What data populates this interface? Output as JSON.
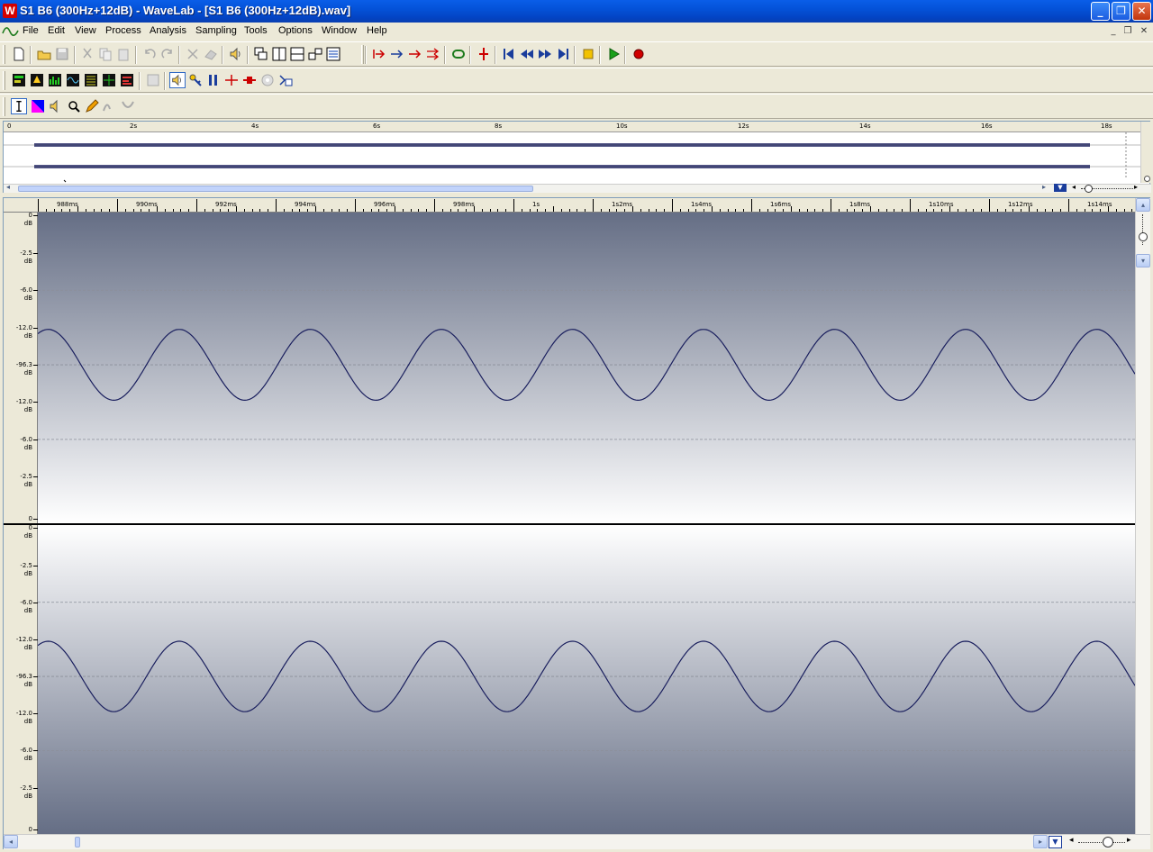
{
  "window": {
    "title": "S1 B6 (300Hz+12dB) - WaveLab - [S1 B6 (300Hz+12dB).wav]",
    "app_icon": "W"
  },
  "menu": [
    "File",
    "Edit",
    "View",
    "Process",
    "Analysis",
    "Sampling",
    "Tools",
    "Options",
    "Window",
    "Help"
  ],
  "overview": {
    "ruler_labels": [
      "0",
      "2s",
      "4s",
      "6s",
      "8s",
      "10s",
      "12s",
      "14s",
      "16s",
      "18s"
    ]
  },
  "editor": {
    "ruler_labels": [
      "988ms",
      "990ms",
      "992ms",
      "994ms",
      "996ms",
      "998ms",
      "1s",
      "1s2ms",
      "1s4ms",
      "1s6ms",
      "1s8ms",
      "1s10ms",
      "1s12ms",
      "1s14ms"
    ],
    "db_labels_top": [
      {
        "value": "0",
        "unit": "dB"
      },
      {
        "value": "-2.5",
        "unit": "dB"
      },
      {
        "value": "-6.0",
        "unit": "dB"
      },
      {
        "value": "-12.0",
        "unit": "dB"
      },
      {
        "value": "-96.3",
        "unit": "dB"
      },
      {
        "value": "-12.0",
        "unit": "dB"
      },
      {
        "value": "-6.0",
        "unit": "dB"
      },
      {
        "value": "-2.5",
        "unit": "dB"
      },
      {
        "value": "0",
        "unit": ""
      }
    ],
    "db_labels_bottom": [
      {
        "value": "0",
        "unit": "dB"
      },
      {
        "value": "-2.5",
        "unit": "dB"
      },
      {
        "value": "-6.0",
        "unit": "dB"
      },
      {
        "value": "-12.0",
        "unit": "dB"
      },
      {
        "value": "-96.3",
        "unit": "dB"
      },
      {
        "value": "-12.0",
        "unit": "dB"
      },
      {
        "value": "-6.0",
        "unit": "dB"
      },
      {
        "value": "-2.5",
        "unit": "dB"
      },
      {
        "value": "0",
        "unit": ""
      }
    ],
    "waveform": {
      "channels": 2,
      "frequency_hz": 300,
      "peak_db": -12.0,
      "cycles_visible": 8.5,
      "line_color": "#1a1f5e",
      "bg_top": "#656e85",
      "bg_bottom": "#ffffff"
    }
  },
  "colors": {
    "title_bar": "#0452d8",
    "chrome": "#ece9d8",
    "play_green": "#1aa01a",
    "record_red": "#d00000"
  }
}
